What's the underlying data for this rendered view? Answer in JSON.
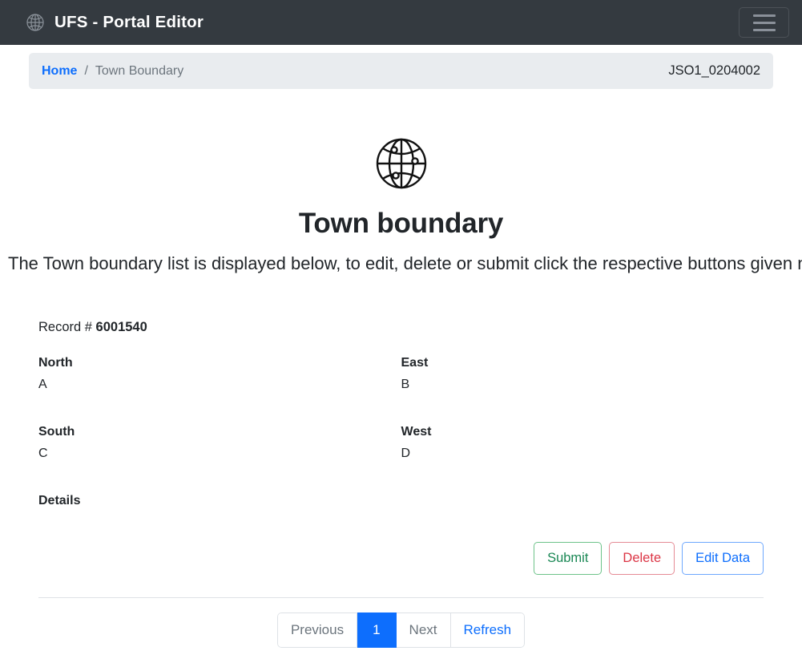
{
  "navbar": {
    "brand_icon": "globe-icon",
    "brand": "UFS - Portal Editor",
    "toggle_icon": "hamburger-icon",
    "background": "#343a40"
  },
  "breadcrumb": {
    "home_label": "Home",
    "separator": "/",
    "current_label": "Town Boundary",
    "reference_id": "JSO1_0204002",
    "link_color": "#0d6efd",
    "background": "#e9ecef"
  },
  "hero": {
    "icon": "globe-icon",
    "title": "Town boundary",
    "description": "The Town boundary list is displayed below, to edit, delete or submit click the respective buttons given next to it."
  },
  "record": {
    "record_label": "Record # ",
    "record_number": "6001540",
    "fields": [
      {
        "label": "North",
        "value": "A"
      },
      {
        "label": "East",
        "value": "B"
      },
      {
        "label": "South",
        "value": "C"
      },
      {
        "label": "West",
        "value": "D"
      },
      {
        "label": "Details",
        "value": ""
      }
    ],
    "actions": [
      {
        "label": "Submit",
        "color": "#198754"
      },
      {
        "label": "Delete",
        "color": "#dc3545"
      },
      {
        "label": "Edit Data",
        "color": "#0d6efd"
      }
    ]
  },
  "pagination": {
    "previous_label": "Previous",
    "current_page": "1",
    "next_label": "Next",
    "refresh_label": "Refresh",
    "active_color": "#0d6efd"
  }
}
